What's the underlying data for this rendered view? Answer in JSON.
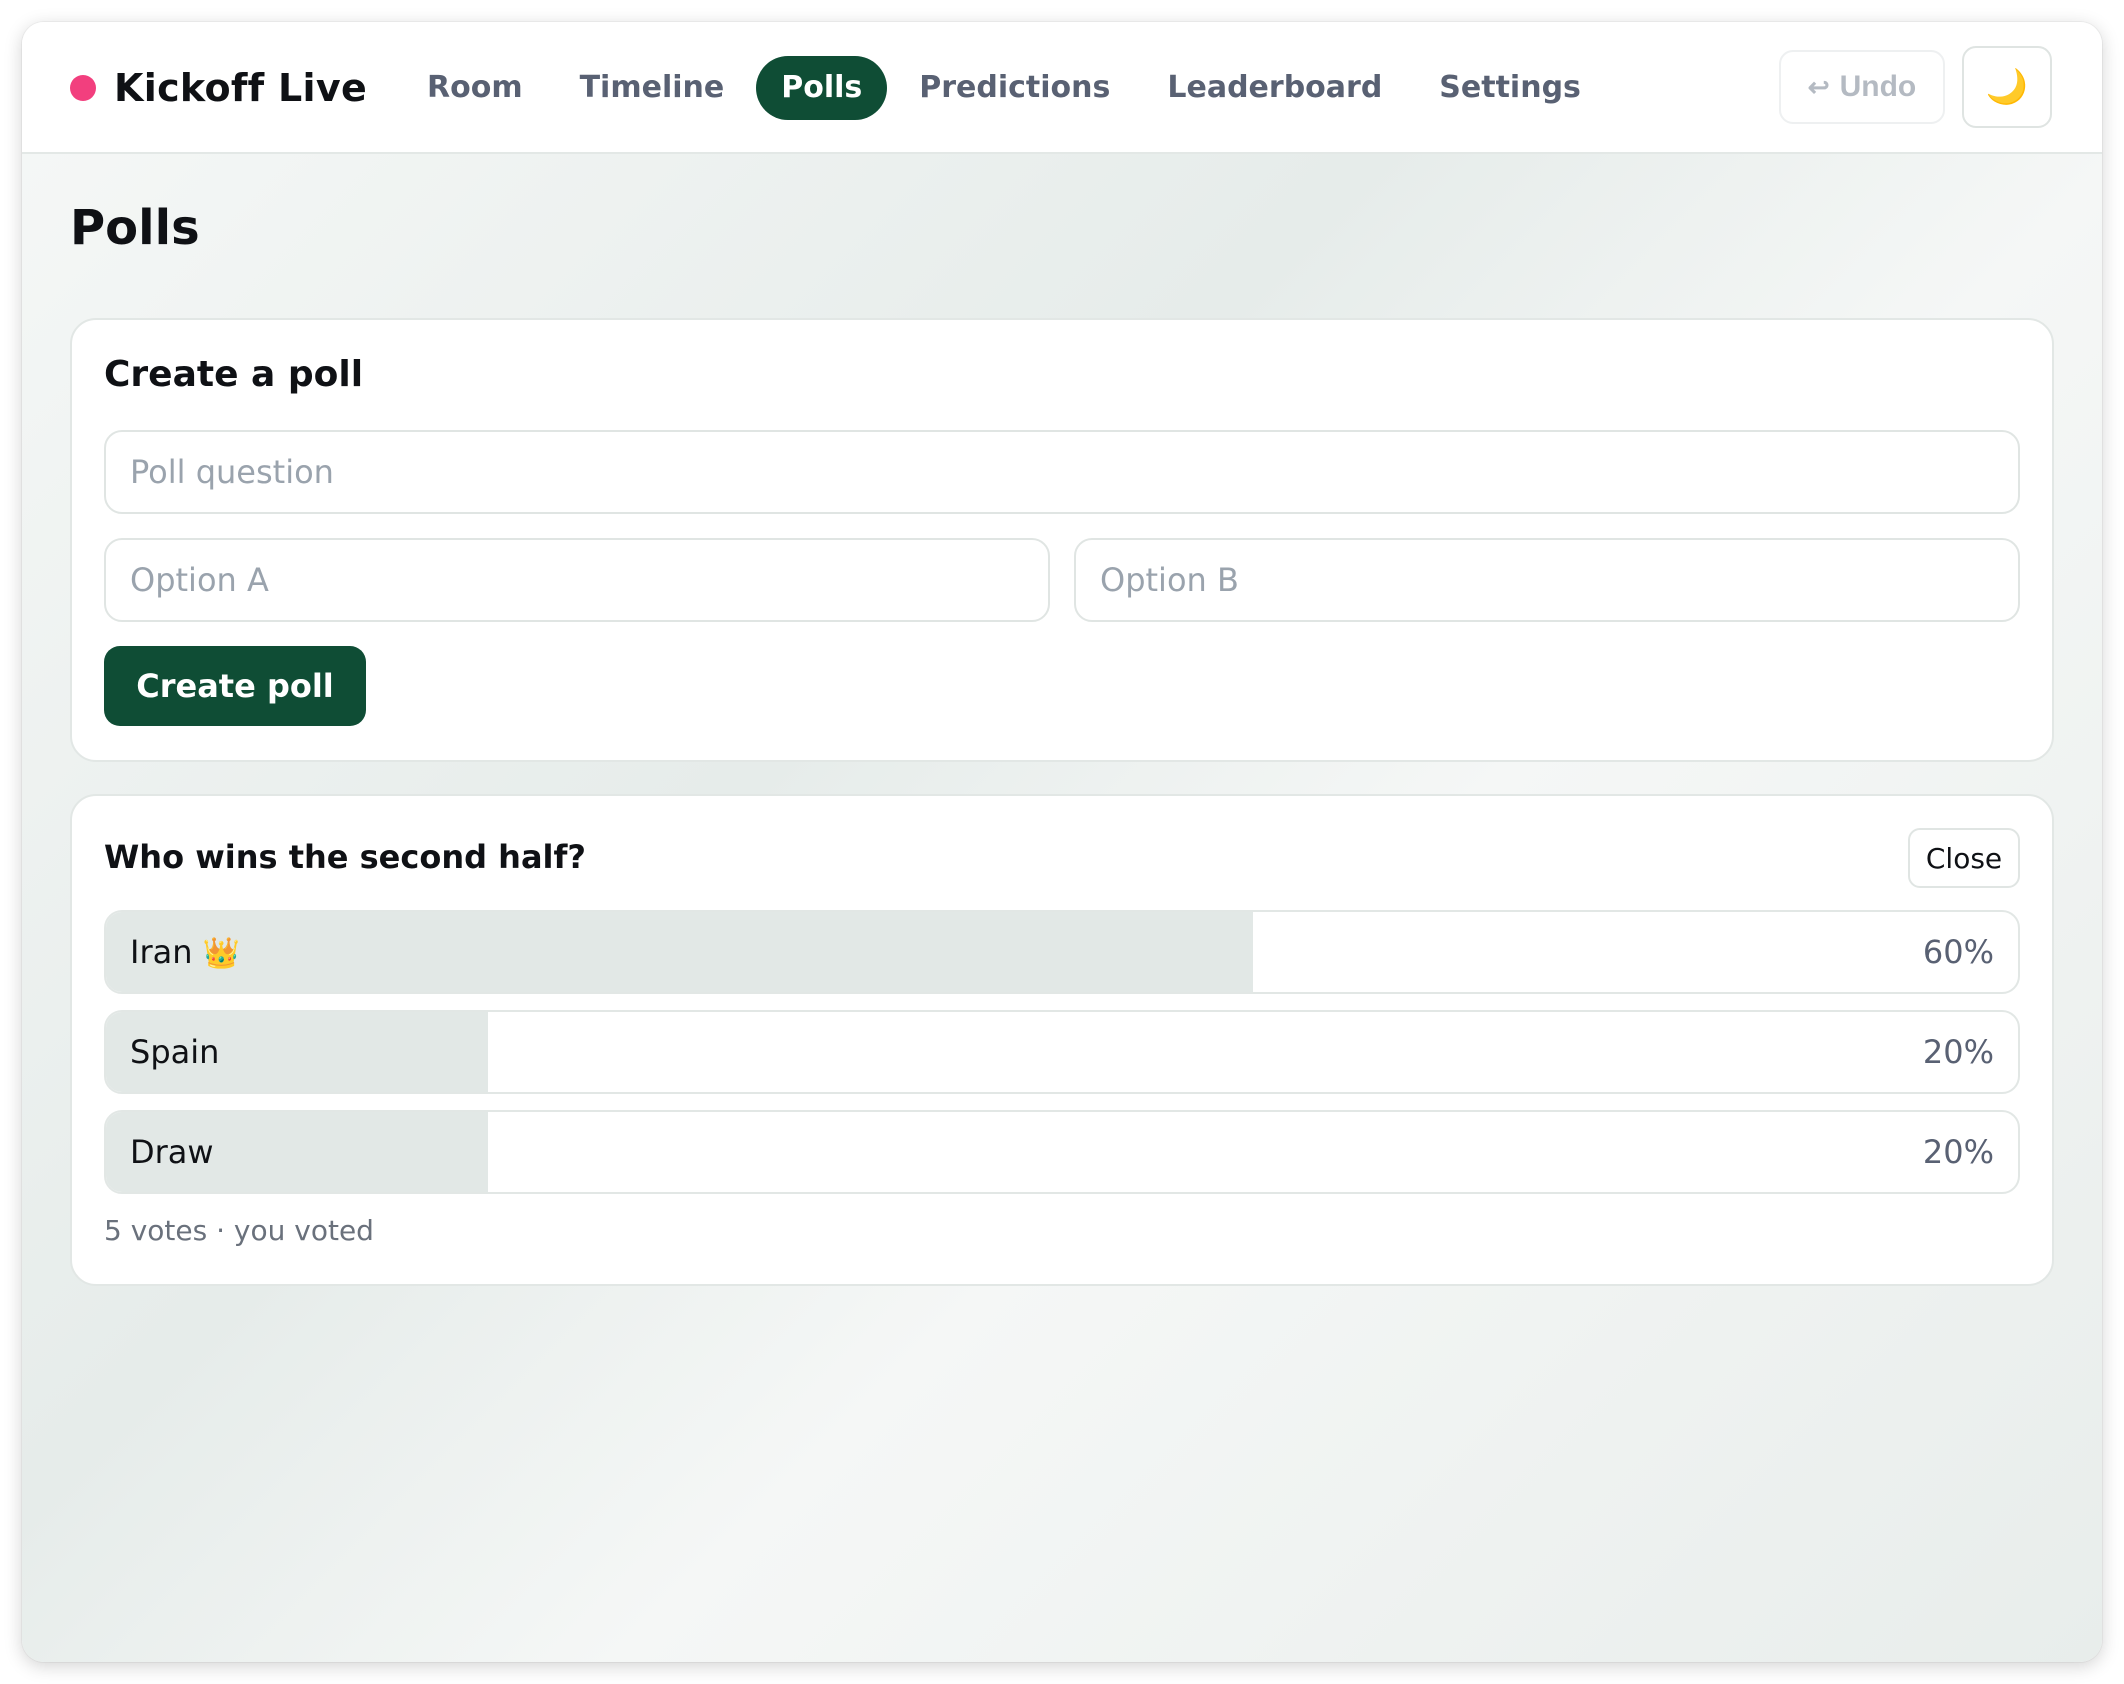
{
  "app": {
    "name": "Kickoff Live",
    "live_dot_color": "#f23f7e"
  },
  "nav": {
    "items": [
      {
        "label": "Room",
        "active": false
      },
      {
        "label": "Timeline",
        "active": false
      },
      {
        "label": "Polls",
        "active": true
      },
      {
        "label": "Predictions",
        "active": false
      },
      {
        "label": "Leaderboard",
        "active": false
      },
      {
        "label": "Settings",
        "active": false
      }
    ]
  },
  "header": {
    "undo_icon": "undo-arrow-icon",
    "undo_glyph": "↩",
    "undo_label": "Undo",
    "undo_enabled": false,
    "theme_icon": "moon-icon",
    "theme_glyph": "🌙"
  },
  "page": {
    "title": "Polls"
  },
  "create_poll": {
    "title": "Create a poll",
    "question_placeholder": "Poll question",
    "question_value": "",
    "option_a_placeholder": "Option A",
    "option_a_value": "",
    "option_b_placeholder": "Option B",
    "option_b_value": "",
    "submit_label": "Create poll"
  },
  "poll": {
    "question": "Who wins the second half?",
    "close_label": "Close",
    "options": [
      {
        "label": "Iran",
        "percent_text": "60%",
        "percent": 60,
        "leader": true,
        "leader_icon": "crown-icon",
        "leader_glyph": "👑"
      },
      {
        "label": "Spain",
        "percent_text": "20%",
        "percent": 20,
        "leader": false
      },
      {
        "label": "Draw",
        "percent_text": "20%",
        "percent": 20,
        "leader": false
      }
    ],
    "meta": "5 votes · you voted"
  },
  "colors": {
    "accent": "#0f4d35",
    "bar_fill": "#e2e8e6",
    "nav_text": "#596173"
  }
}
